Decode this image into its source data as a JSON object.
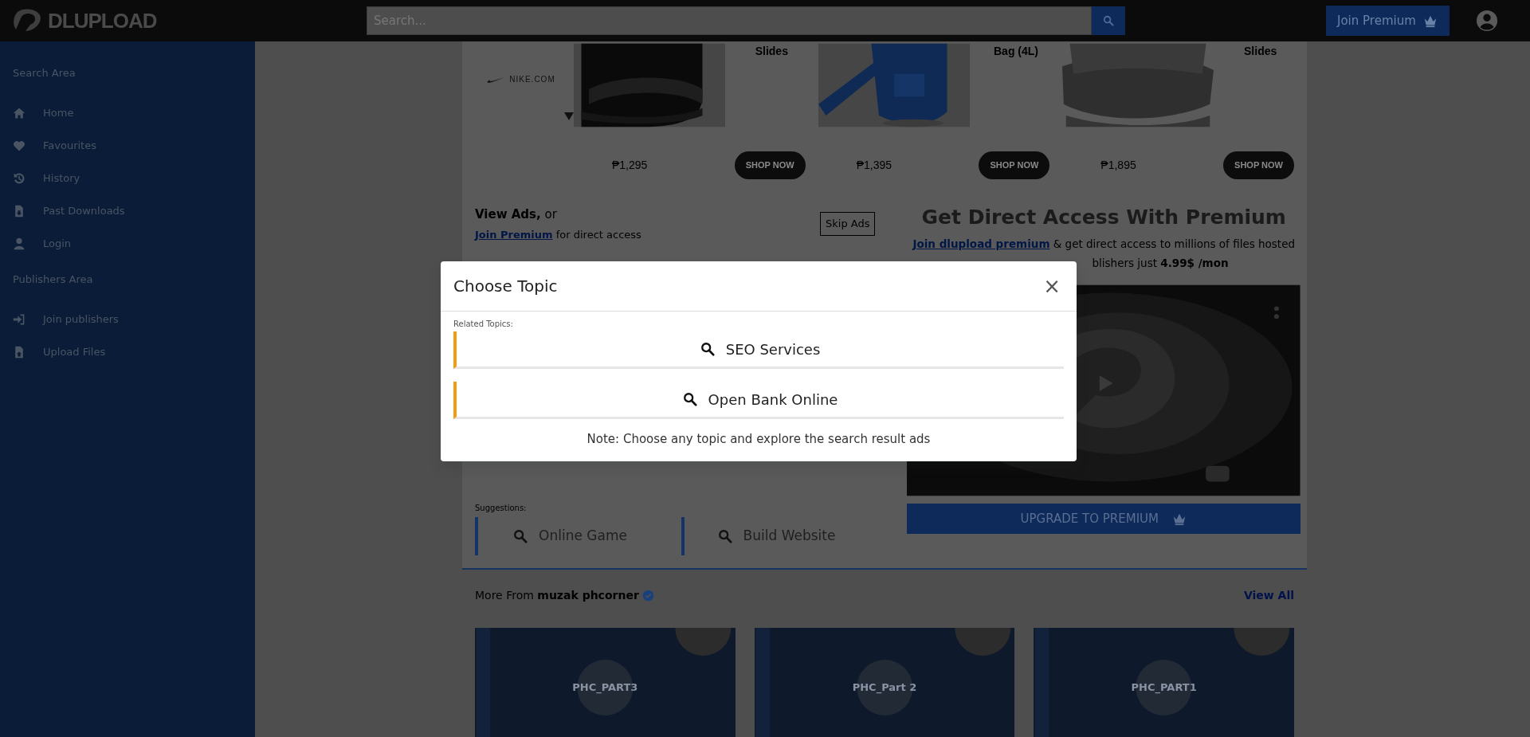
{
  "header": {
    "logo": "DLUPLOAD",
    "search": {
      "placeholder": "Search..."
    },
    "premium_button": "Join Premium"
  },
  "sidebar": {
    "sections": [
      {
        "title": "Search Area",
        "items": [
          {
            "label": "Home"
          },
          {
            "label": "Favourites"
          },
          {
            "label": "History"
          },
          {
            "label": "Past Downloads"
          },
          {
            "label": "Login"
          }
        ]
      },
      {
        "title": "Publishers Area",
        "items": [
          {
            "label": "Join publishers"
          },
          {
            "label": "Upload Files"
          }
        ]
      }
    ]
  },
  "ad_banner": {
    "brand": "NIKE.COM",
    "products": [
      {
        "name": "Slides",
        "price": "₱1,295",
        "button": "SHOP NOW"
      },
      {
        "name": "Bag (4L)",
        "price": "₱1,395",
        "button": "SHOP NOW"
      },
      {
        "name": "Slides",
        "price": "₱1,895",
        "button": "SHOP NOW"
      }
    ]
  },
  "view_ads": {
    "heading": "**View Ads,** or",
    "link": "Join Premium",
    "text": "for direct access",
    "skip_button": "Skip Ads"
  },
  "suggestions": {
    "label": "Suggestions:",
    "items": [
      "Online Game",
      "Build Website"
    ]
  },
  "premium": {
    "title": "Get Direct Access With Premium",
    "link": "Join dlupload premium",
    "text": "& get direct access to millions of files hosted",
    "text_2": "blishers just **4.99$ /mon**",
    "button": "UPGRADE TO PREMIUM"
  },
  "more_from": {
    "text": "More From **muzak phcorner**",
    "verified": true,
    "view_all": "View All"
  },
  "files": [
    {
      "title": "PHC_PART3"
    },
    {
      "title": "PHC_Part 2"
    },
    {
      "title": "PHC_PART1"
    }
  ],
  "modal": {
    "title": "Choose Topic",
    "close": "×",
    "label": "Related Topics:",
    "topics": [
      "SEO Services",
      "Open Bank Online"
    ],
    "note": "Note: Choose any topic and explore the search result ads"
  }
}
